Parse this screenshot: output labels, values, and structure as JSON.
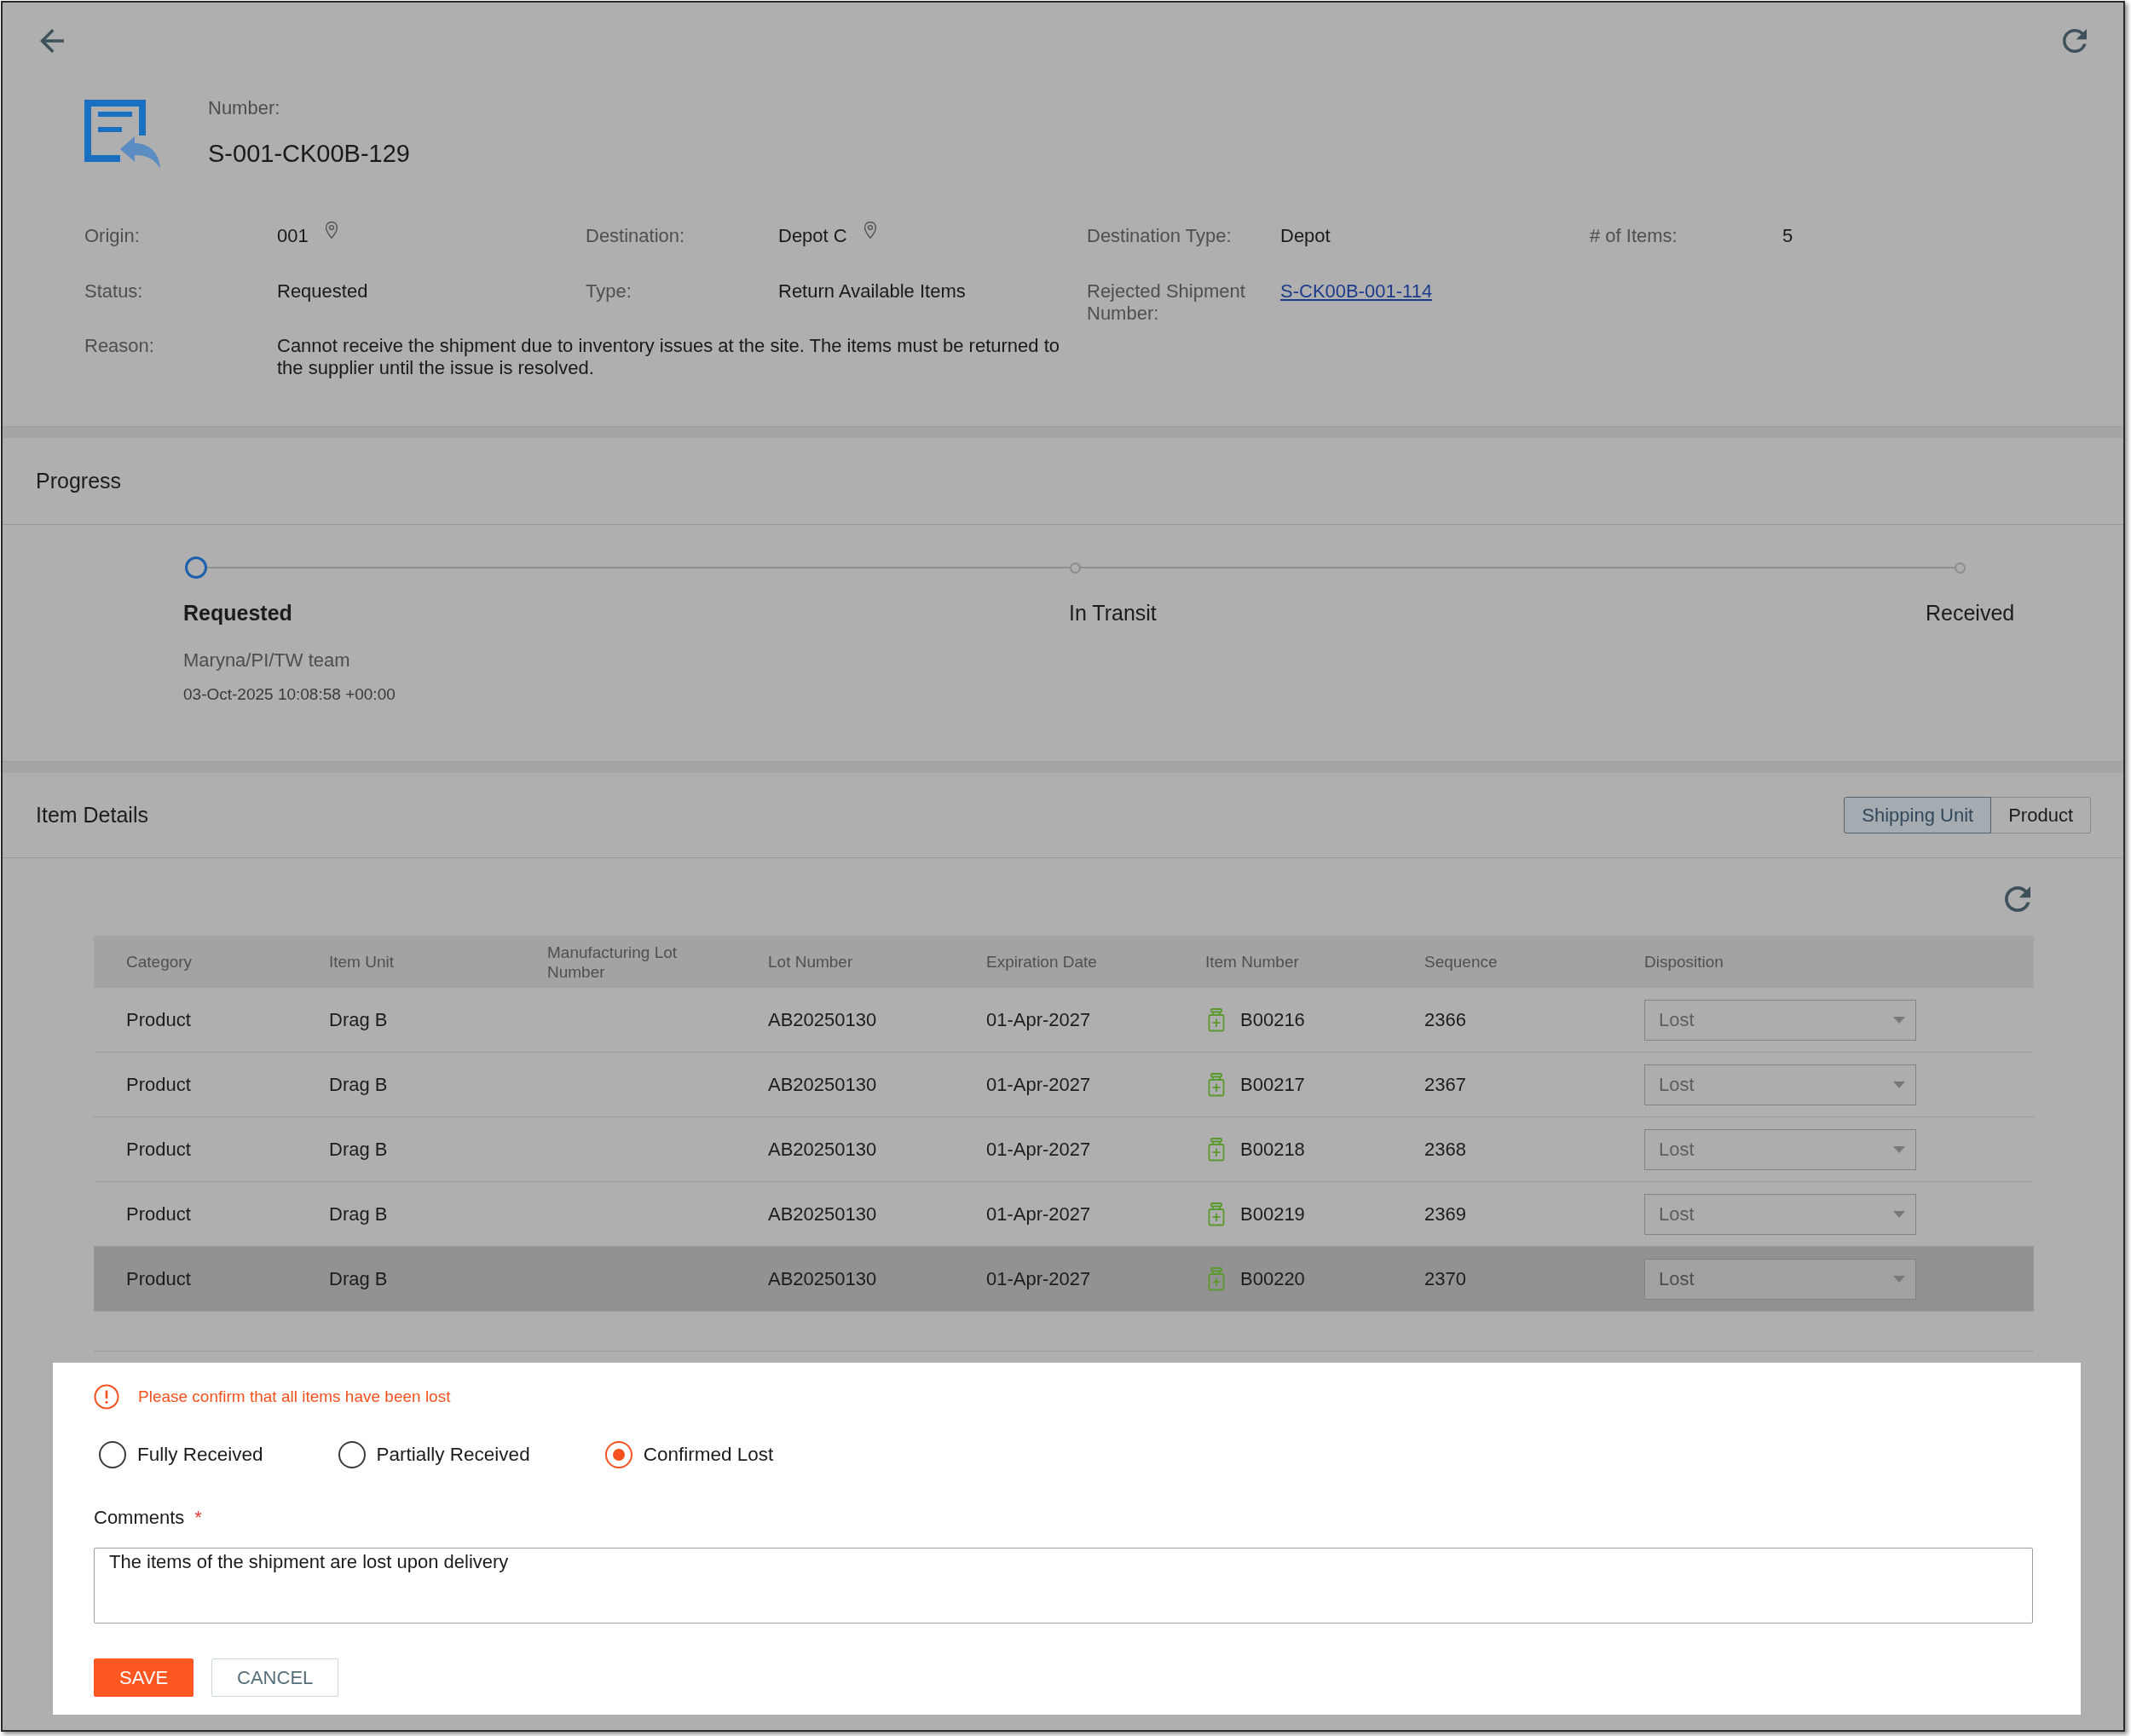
{
  "header": {
    "number_label": "Number:",
    "number": "S-001-CK00B-129"
  },
  "summary": {
    "rows": [
      {
        "fields": [
          {
            "label": "Origin:",
            "value": "001",
            "kind": "location"
          },
          {
            "label": "Destination:",
            "value": "Depot C",
            "kind": "location"
          },
          {
            "label": "Destination Type:",
            "value": "Depot",
            "kind": "text"
          },
          {
            "label": "# of Items:",
            "value": "5",
            "kind": "text"
          }
        ]
      },
      {
        "fields": [
          {
            "label": "Status:",
            "value": "Requested",
            "kind": "text"
          },
          {
            "label": "Type:",
            "value": "Return Available Items",
            "kind": "text"
          },
          {
            "label": "Rejected Shipment Number:",
            "value": "S-CK00B-001-114",
            "kind": "link"
          }
        ]
      },
      {
        "fields": [
          {
            "label": "Reason:",
            "value": "Cannot receive the shipment due to inventory issues at the site. The items must be returned to the supplier until the issue is resolved.",
            "kind": "long"
          }
        ]
      }
    ]
  },
  "progress": {
    "title": "Progress",
    "steps": [
      {
        "label": "Requested",
        "current": true,
        "user": "Maryna/PI/TW team",
        "time": "03-Oct-2025 10:08:58 +00:00"
      },
      {
        "label": "In Transit",
        "current": false
      },
      {
        "label": "Received",
        "current": false
      }
    ]
  },
  "item_details": {
    "title": "Item Details",
    "views": [
      {
        "label": "Shipping Unit",
        "selected": true
      },
      {
        "label": "Product",
        "selected": false
      }
    ],
    "table": {
      "columns": [
        "Category",
        "Item Unit",
        "Manufacturing Lot Number",
        "Lot Number",
        "Expiration Date",
        "Item Number",
        "Sequence",
        "Disposition"
      ],
      "rows": [
        {
          "category": "Product",
          "item_unit": "Drag B",
          "lot_number": "AB20250130",
          "expiration_date": "01-Apr-2027",
          "item_number": "B00216",
          "sequence": "2366",
          "disposition": "Lost",
          "disposition_disabled": true,
          "highlighted": false
        },
        {
          "category": "Product",
          "item_unit": "Drag B",
          "lot_number": "AB20250130",
          "expiration_date": "01-Apr-2027",
          "item_number": "B00217",
          "sequence": "2367",
          "disposition": "Lost",
          "disposition_disabled": true,
          "highlighted": false
        },
        {
          "category": "Product",
          "item_unit": "Drag B",
          "lot_number": "AB20250130",
          "expiration_date": "01-Apr-2027",
          "item_number": "B00218",
          "sequence": "2368",
          "disposition": "Lost",
          "disposition_disabled": true,
          "highlighted": false
        },
        {
          "category": "Product",
          "item_unit": "Drag B",
          "lot_number": "AB20250130",
          "expiration_date": "01-Apr-2027",
          "item_number": "B00219",
          "sequence": "2369",
          "disposition": "Lost",
          "disposition_disabled": true,
          "highlighted": false
        },
        {
          "category": "Product",
          "item_unit": "Drag B",
          "lot_number": "AB20250130",
          "expiration_date": "01-Apr-2027",
          "item_number": "B00220",
          "sequence": "2370",
          "disposition": "Lost",
          "disposition_disabled": true,
          "highlighted": true
        }
      ]
    }
  },
  "confirmation": {
    "message": "Please confirm that all items have been lost",
    "options": [
      {
        "label": "Fully Received",
        "selected": false
      },
      {
        "label": "Partially Received",
        "selected": false
      },
      {
        "label": "Confirmed Lost",
        "selected": true
      }
    ],
    "comments": {
      "label": "Comments",
      "required_mark": "*",
      "value": "The items of the shipment are lost upon delivery"
    },
    "buttons": [
      {
        "label": "SAVE",
        "kind": "primary"
      },
      {
        "label": "CANCEL",
        "kind": "secondary"
      }
    ]
  }
}
